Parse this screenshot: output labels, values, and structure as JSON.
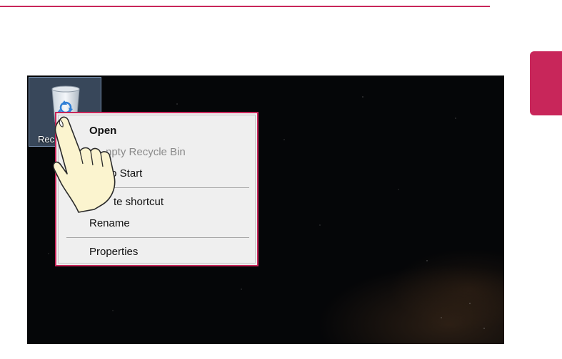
{
  "desktop": {
    "icon_label": "Recycle Bin",
    "icon_label_visible": "Rec"
  },
  "context_menu": {
    "items": [
      {
        "label": "Open",
        "style": "bold"
      },
      {
        "label": "Empty Recycle Bin",
        "style": "disabled",
        "visible": "npty Recycle Bin"
      },
      {
        "label": "Pin to Start",
        "visible": "to Start"
      },
      {
        "label": "Create shortcut",
        "visible": "te shortcut"
      },
      {
        "label": "Rename"
      },
      {
        "label": "Properties"
      }
    ]
  },
  "colors": {
    "accent": "#c8265a",
    "menu_bg": "#efefef",
    "desktop_bg": "#050608"
  },
  "icons": [
    "recycle-bin-icon",
    "pointing-hand-icon"
  ]
}
